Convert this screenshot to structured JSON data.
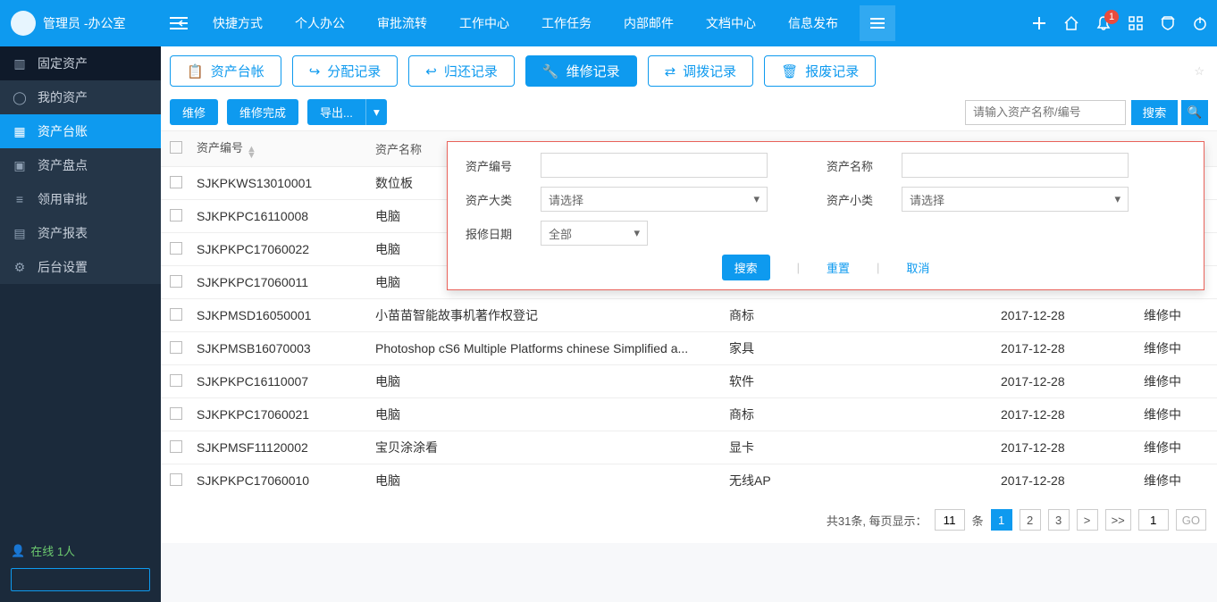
{
  "header": {
    "user": "管理员 -办公室",
    "nav": [
      "快捷方式",
      "个人办公",
      "审批流转",
      "工作中心",
      "工作任务",
      "内部邮件",
      "文档中心",
      "信息发布"
    ],
    "notif_badge": "1"
  },
  "sidebar": {
    "items": [
      {
        "label": "固定资产"
      },
      {
        "label": "我的资产"
      },
      {
        "label": "资产台账"
      },
      {
        "label": "资产盘点"
      },
      {
        "label": "领用审批"
      },
      {
        "label": "资产报表"
      },
      {
        "label": "后台设置"
      }
    ],
    "online_label": "在线 ",
    "online_count": "1人"
  },
  "tabs": [
    {
      "label": "资产台帐"
    },
    {
      "label": "分配记录"
    },
    {
      "label": "归还记录"
    },
    {
      "label": "维修记录"
    },
    {
      "label": "调拨记录"
    },
    {
      "label": "报废记录"
    }
  ],
  "actions": {
    "repair": "维修",
    "repair_done": "维修完成",
    "export": "导出...",
    "search_placeholder": "请输入资产名称/编号",
    "search_btn": "搜索"
  },
  "adv": {
    "code_label": "资产编号",
    "name_label": "资产名称",
    "major_label": "资产大类",
    "minor_label": "资产小类",
    "date_label": "报修日期",
    "select_placeholder": "请选择",
    "date_all": "全部",
    "search": "搜索",
    "reset": "重置",
    "cancel": "取消"
  },
  "table": {
    "headers": {
      "id": "资产编号",
      "name": "资产名称"
    },
    "rows": [
      {
        "id": "SJKPKWS13010001",
        "name": "数位板",
        "cat": "",
        "date": "",
        "status": ""
      },
      {
        "id": "SJKPKPC16110008",
        "name": "电脑",
        "cat": "",
        "date": "",
        "status": ""
      },
      {
        "id": "SJKPKPC17060022",
        "name": "电脑",
        "cat": "",
        "date": "",
        "status": ""
      },
      {
        "id": "SJKPKPC17060011",
        "name": "电脑",
        "cat": "",
        "date": "",
        "status": ""
      },
      {
        "id": "SJKPMSD16050001",
        "name": "小苗苗智能故事机著作权登记",
        "cat": "商标",
        "date": "2017-12-28",
        "status": "维修中"
      },
      {
        "id": "SJKPMSB16070003",
        "name": "Photoshop cS6 Multiple Platforms chinese Simplified a...",
        "cat": "家具",
        "date": "2017-12-28",
        "status": "维修中"
      },
      {
        "id": "SJKPKPC16110007",
        "name": "电脑",
        "cat": "软件",
        "date": "2017-12-28",
        "status": "维修中"
      },
      {
        "id": "SJKPKPC17060021",
        "name": "电脑",
        "cat": "商标",
        "date": "2017-12-28",
        "status": "维修中"
      },
      {
        "id": "SJKPMSF11120002",
        "name": "宝贝涂涂看",
        "cat": "显卡",
        "date": "2017-12-28",
        "status": "维修中"
      },
      {
        "id": "SJKPKPC17060010",
        "name": "电脑",
        "cat": "无线AP",
        "date": "2017-12-28",
        "status": "维修中"
      }
    ]
  },
  "pager": {
    "total": "共31条, 每页显示：",
    "per_page": "11",
    "unit": "条",
    "pages": [
      "1",
      "2",
      "3"
    ],
    "next": ">",
    "last": ">>",
    "goto": "1",
    "go": "GO"
  }
}
